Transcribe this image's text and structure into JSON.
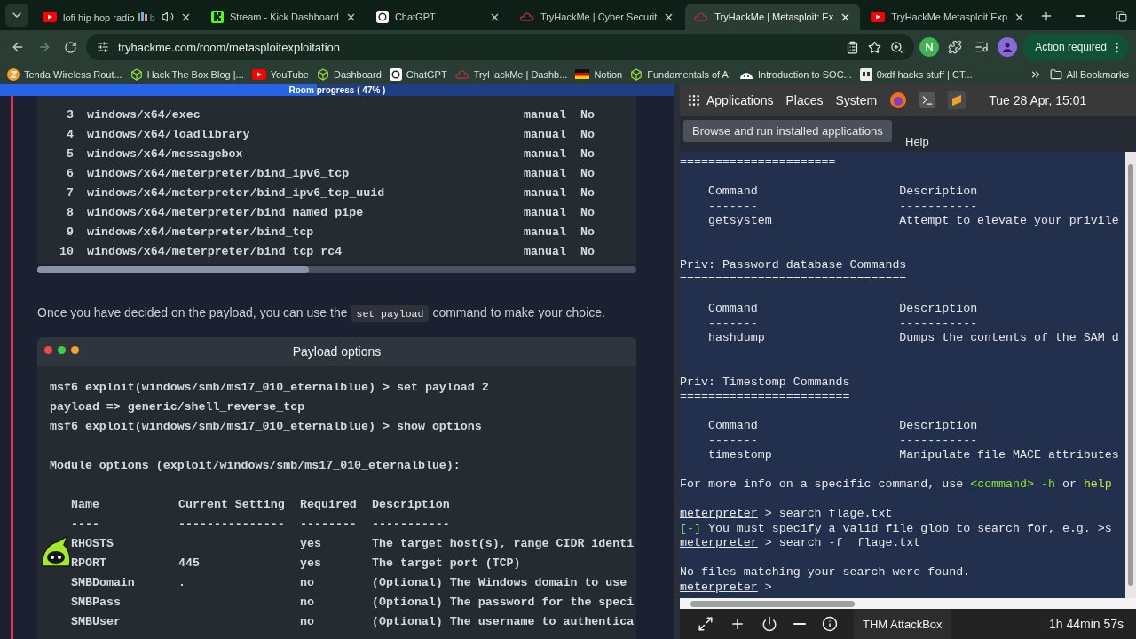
{
  "browser": {
    "tabs": [
      {
        "kind": "youtube",
        "title": "lofi hip hop radio",
        "title_tail": "b",
        "audio": true,
        "selected": false
      },
      {
        "kind": "kick",
        "title": "Stream - Kick Dashboard",
        "audio": false,
        "selected": false
      },
      {
        "kind": "chatgpt",
        "title": "ChatGPT",
        "audio": false,
        "selected": false
      },
      {
        "kind": "thm",
        "title": "TryHackMe | Cyber Securit",
        "audio": false,
        "selected": false
      },
      {
        "kind": "thm",
        "title": "TryHackMe | Metasploit: Ex",
        "audio": false,
        "selected": true
      },
      {
        "kind": "youtube",
        "title": "TryHackMe Metasploit Exp",
        "audio": false,
        "selected": false
      }
    ],
    "url": "tryhackme.com/room/metasploitexploitation",
    "action_button": "Action required",
    "bookmarks": [
      {
        "kind": "router",
        "label": "Tenda Wireless Rout..."
      },
      {
        "kind": "box",
        "label": "Hack The Box Blog |..."
      },
      {
        "kind": "youtube",
        "label": "YouTube"
      },
      {
        "kind": "box",
        "label": "Dashboard"
      },
      {
        "kind": "chatgpt",
        "label": "ChatGPT"
      },
      {
        "kind": "thm",
        "label": "TryHackMe | Dashb..."
      },
      {
        "kind": "flag",
        "label": "Notion"
      },
      {
        "kind": "box",
        "label": "Fundamentals of AI"
      },
      {
        "kind": "mascot",
        "label": "Introduction to SOC..."
      },
      {
        "kind": "page",
        "label": "0xdf hacks stuff | CT..."
      }
    ],
    "all_bookmarks": "All Bookmarks"
  },
  "lesson": {
    "progress": {
      "label": "Room progress ( 47% )",
      "level": 0.47
    },
    "payload_table": [
      {
        "number": "3",
        "name": "windows/x64/exec",
        "type": "manual",
        "check": "No"
      },
      {
        "number": "4",
        "name": "windows/x64/loadlibrary",
        "type": "manual",
        "check": "No"
      },
      {
        "number": "5",
        "name": "windows/x64/messagebox",
        "type": "manual",
        "check": "No"
      },
      {
        "number": "6",
        "name": "windows/x64/meterpreter/bind_ipv6_tcp",
        "type": "manual",
        "check": "No"
      },
      {
        "number": "7",
        "name": "windows/x64/meterpreter/bind_ipv6_tcp_uuid",
        "type": "manual",
        "check": "No"
      },
      {
        "number": "8",
        "name": "windows/x64/meterpreter/bind_named_pipe",
        "type": "manual",
        "check": "No"
      },
      {
        "number": "9",
        "name": "windows/x64/meterpreter/bind_tcp",
        "type": "manual",
        "check": "No"
      },
      {
        "number": "10",
        "name": "windows/x64/meterpreter/bind_tcp_rc4",
        "type": "manual",
        "check": "No"
      }
    ],
    "paragraph": {
      "before": "Once you have decided on the payload, you can use the",
      "code": "set payload",
      "after": "command to make your choice."
    },
    "terminal": {
      "title": "Payload options",
      "commands": [
        "msf6 exploit(windows/smb/ms17_010_eternalblue) > set payload 2",
        "payload => generic/shell_reverse_tcp",
        "msf6 exploit(windows/smb/ms17_010_eternalblue) > show options"
      ],
      "module_heading": "Module options (exploit/windows/smb/ms17_010_eternalblue):",
      "columns": [
        "Name",
        "Current Setting",
        "Required",
        "Description"
      ],
      "dashes": [
        "----",
        "---------------",
        "--------",
        "-----------"
      ],
      "options": [
        {
          "name": "RHOSTS",
          "required": "yes",
          "description": "The target host(s), range CIDR identi"
        },
        {
          "name": "RPORT",
          "setting": "445",
          "required": "yes",
          "description": "The target port (TCP)"
        },
        {
          "name": "SMBDomain",
          "setting": ".",
          "required": "no",
          "description": "(Optional) The Windows domain to use"
        },
        {
          "name": "SMBPass",
          "required": "no",
          "description": "(Optional) The password for the speci"
        },
        {
          "name": "SMBUser",
          "required": "no",
          "description": "(Optional) The username to authentica"
        }
      ]
    }
  },
  "attackbox": {
    "menus": [
      "Applications",
      "Places",
      "System"
    ],
    "clock": "Tue 28 Apr, 15:01",
    "tooltip": "Browse and run installed applications",
    "terminal_menu": [
      "Help"
    ],
    "lines": [
      {
        "kind": "text",
        "text": "======================"
      },
      {
        "kind": "gap"
      },
      {
        "kind": "columns",
        "left": "Command",
        "right": "Description"
      },
      {
        "kind": "columns",
        "left": "-------",
        "right": "-----------"
      },
      {
        "kind": "columns",
        "left": "getsystem",
        "right": "Attempt to elevate your privile"
      },
      {
        "kind": "gap"
      },
      {
        "kind": "gap"
      },
      {
        "kind": "text",
        "text": "Priv: Password database Commands"
      },
      {
        "kind": "text",
        "text": "================================"
      },
      {
        "kind": "gap"
      },
      {
        "kind": "columns",
        "left": "Command",
        "right": "Description"
      },
      {
        "kind": "columns",
        "left": "-------",
        "right": "-----------"
      },
      {
        "kind": "columns",
        "left": "hashdump",
        "right": "Dumps the contents of the SAM d"
      },
      {
        "kind": "gap"
      },
      {
        "kind": "gap"
      },
      {
        "kind": "text",
        "text": "Priv: Timestomp Commands"
      },
      {
        "kind": "text",
        "text": "========================"
      },
      {
        "kind": "gap"
      },
      {
        "kind": "columns",
        "left": "Command",
        "right": "Description"
      },
      {
        "kind": "columns",
        "left": "-------",
        "right": "-----------"
      },
      {
        "kind": "columns",
        "left": "timestomp",
        "right": "Manipulate file MACE attributes"
      },
      {
        "kind": "gap"
      },
      {
        "kind": "segments",
        "segments": [
          {
            "text": "For more info on a specific command, use",
            "color": "#e6e6e6"
          },
          {
            "text": "<command> -h",
            "color": "#8ae234"
          },
          {
            "text": "or",
            "color": "#e6e6e6"
          },
          {
            "text": "help",
            "color": "#c8e63a"
          }
        ]
      },
      {
        "kind": "gap"
      },
      {
        "kind": "prompt",
        "prompt": "meterpreter",
        "text": "> search flage.txt"
      },
      {
        "kind": "error",
        "tag": "[-]",
        "text": "You must specify a valid file glob to search for, e.g. >s"
      },
      {
        "kind": "prompt",
        "prompt": "meterpreter",
        "text": "> search -f  flage.txt"
      },
      {
        "kind": "gap"
      },
      {
        "kind": "text",
        "text": "No files matching your search were found."
      },
      {
        "kind": "prompt",
        "prompt": "meterpreter",
        "text": ">"
      }
    ],
    "toolbar_title": "THM AttackBox",
    "timer": "1h 44min 57s"
  }
}
